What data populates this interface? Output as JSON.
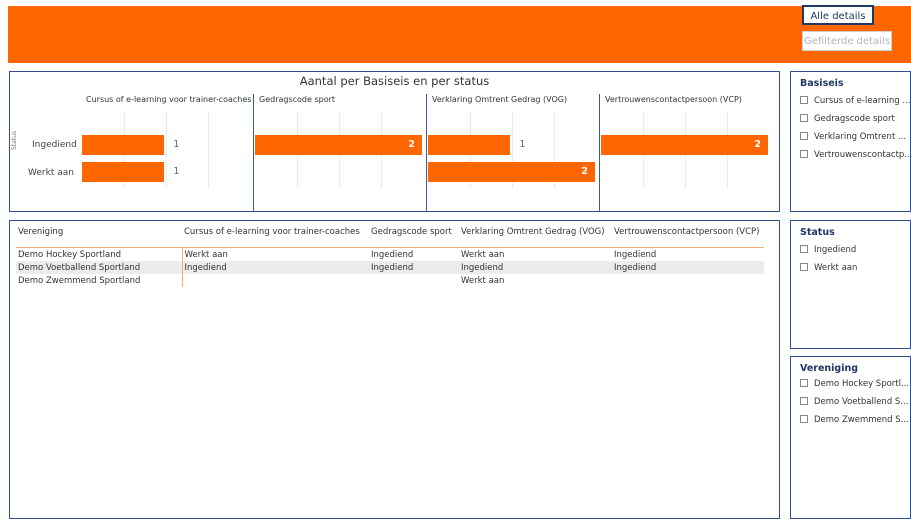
{
  "header": {
    "buttons": {
      "all_details": "Alle details",
      "filtered_details": "Gefilterde details"
    },
    "color": "#ff6600"
  },
  "chart": {
    "title": "Aantal per Basiseis en per status",
    "axis_label": "Status",
    "categories": [
      "Ingediend",
      "Werkt aan"
    ],
    "facets": [
      "Cursus of e-learning voor trainer-coaches",
      "Gedragscode sport",
      "Verklaring Omtrent Gedrag (VOG)",
      "Vertrouwenscontactpersoon (VCP)"
    ]
  },
  "chart_data": {
    "type": "bar",
    "title": "Aantal per Basiseis en per status",
    "ylabel": "Status",
    "categories": [
      "Ingediend",
      "Werkt aan"
    ],
    "xlim": [
      0,
      2
    ],
    "panels": [
      {
        "name": "Cursus of e-learning voor trainer-coaches",
        "values": [
          1,
          1
        ],
        "labels": [
          "1",
          "1"
        ]
      },
      {
        "name": "Gedragscode sport",
        "values": [
          2,
          0
        ],
        "labels": [
          "2",
          ""
        ]
      },
      {
        "name": "Verklaring Omtrent Gedrag (VOG)",
        "values": [
          1,
          2
        ],
        "labels": [
          "1",
          "2"
        ]
      },
      {
        "name": "Vertrouwenscontactpersoon (VCP)",
        "values": [
          2,
          0
        ],
        "labels": [
          "2",
          ""
        ]
      }
    ],
    "bar_color": "#ff6600"
  },
  "table": {
    "columns": [
      "Vereniging",
      "Cursus of e-learning voor trainer-coaches",
      "Gedragscode sport",
      "Verklaring Omtrent Gedrag (VOG)",
      "Vertrouwenscontactpersoon (VCP)"
    ],
    "rows": [
      [
        "Demo Hockey Sportland",
        "Werkt aan",
        "Ingediend",
        "Werkt aan",
        "Ingediend"
      ],
      [
        "Demo Voetballend Sportland",
        "Ingediend",
        "Ingediend",
        "Ingediend",
        "Ingediend"
      ],
      [
        "Demo Zwemmend Sportland",
        "",
        "",
        "Werkt aan",
        ""
      ]
    ]
  },
  "slicers": {
    "basiseis": {
      "title": "Basiseis",
      "items": [
        "Cursus of e-learning ...",
        "Gedragscode sport",
        "Verklaring Omtrent ...",
        "Vertrouwenscontactp..."
      ]
    },
    "status": {
      "title": "Status",
      "items": [
        "Ingediend",
        "Werkt aan"
      ]
    },
    "vereniging": {
      "title": "Vereniging",
      "items": [
        "Demo Hockey Sportl...",
        "Demo Voetballend S...",
        "Demo Zwemmend S..."
      ]
    }
  }
}
